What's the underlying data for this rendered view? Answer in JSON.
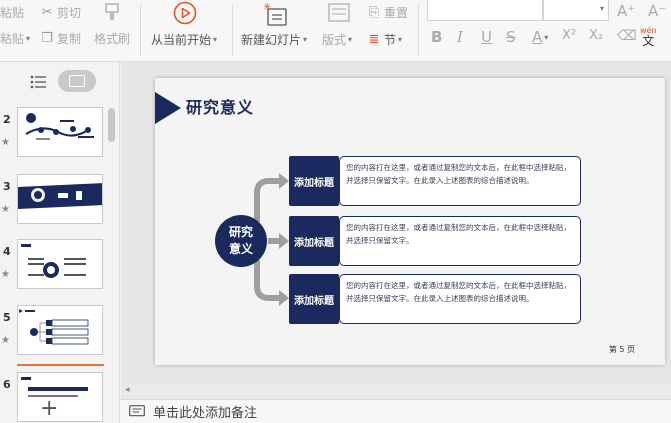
{
  "ribbon": {
    "paste_label": "粘贴",
    "cut_label": "剪切",
    "copy_label": "复制",
    "format_painter_label": "格式刷",
    "from_current_label": "从当前开始",
    "new_slide_label": "新建幻灯片",
    "layout_label": "版式",
    "reset_label": "重置",
    "section_label": "节",
    "bold_glyph": "B",
    "italic_glyph": "I",
    "underline_glyph": "U",
    "strike_glyph": "S",
    "font_color_glyph": "A",
    "superscript_glyph": "X²",
    "subscript_glyph": "X₂",
    "grow_font_glyph": "A⁺",
    "shrink_font_glyph": "A⁻",
    "wen_label": "wén",
    "wen_char": "文",
    "accent_color": "#e4541e"
  },
  "slides_panel": {
    "thumbnails": [
      {
        "number": "2"
      },
      {
        "number": "3"
      },
      {
        "number": "4"
      },
      {
        "number": "5"
      },
      {
        "number": "6"
      }
    ]
  },
  "slide": {
    "title": "研究意义",
    "center_label_line1": "研究",
    "center_label_line2": "意义",
    "items": [
      {
        "tag": "添加标题",
        "text": "您的内容打在这里，或者通过复制您的文本后，在此框中选择粘贴，并选择只保留文字。在此录入上述图表的综合描述说明。"
      },
      {
        "tag": "添加标题",
        "text": "您的内容打在这里，或者通过复制您的文本后，在此框中选择粘贴，并选择只保留文字。"
      },
      {
        "tag": "添加标题",
        "text": "您的内容打在这里，或者通过复制您的文本后，在此框中选择粘贴，并选择只保留文字。在此录入上述图表的综合描述说明。"
      }
    ],
    "page_label": "第 5 页",
    "theme_color": "#1b2a5e"
  },
  "notes": {
    "placeholder": "单击此处添加备注"
  }
}
